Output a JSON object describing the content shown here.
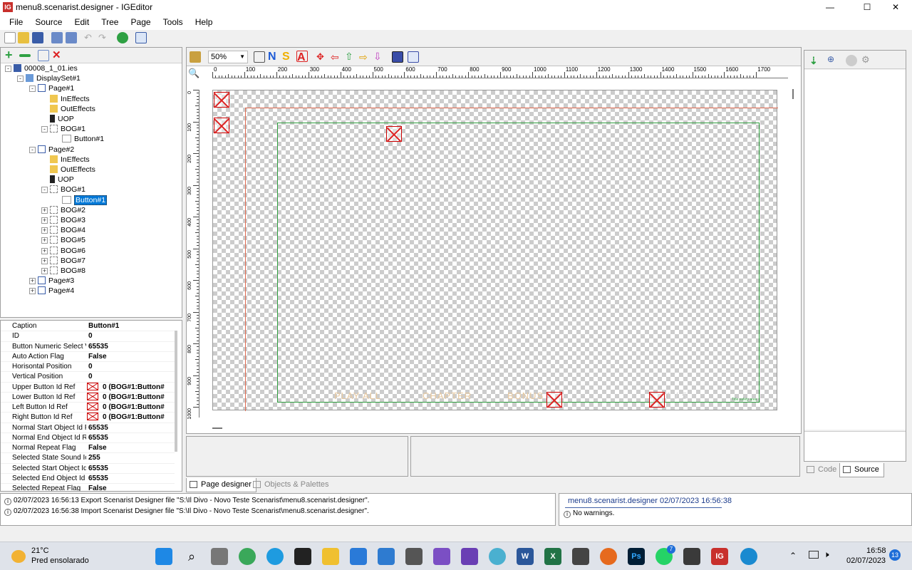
{
  "window": {
    "title": "menu8.scenarist.designer - IGEditor",
    "app_icon": "IG",
    "minimize": "—",
    "maximize": "☐",
    "close": "✕"
  },
  "menu": [
    "File",
    "Source",
    "Edit",
    "Tree",
    "Page",
    "Tools",
    "Help"
  ],
  "tree": [
    {
      "label": "00008_1_01.ies",
      "icon": "project-icon",
      "exp": "-"
    },
    {
      "label": "DisplaySet#1",
      "icon": "displayset-icon",
      "exp": "-"
    },
    {
      "label": "Page#1",
      "icon": "page-icon",
      "exp": "-"
    },
    {
      "label": "InEffects",
      "icon": "folder-icon"
    },
    {
      "label": "OutEffects",
      "icon": "folder-icon"
    },
    {
      "label": "UOP",
      "icon": "uop-icon"
    },
    {
      "label": "BOG#1",
      "icon": "bog-icon",
      "exp": "-"
    },
    {
      "label": "Button#1",
      "icon": "button-icon"
    },
    {
      "label": "Page#2",
      "icon": "page-icon",
      "exp": "-"
    },
    {
      "label": "InEffects",
      "icon": "folder-icon"
    },
    {
      "label": "OutEffects",
      "icon": "folder-icon"
    },
    {
      "label": "UOP",
      "icon": "uop-icon"
    },
    {
      "label": "BOG#1",
      "icon": "bog-icon",
      "exp": "-"
    },
    {
      "label": "Button#1",
      "icon": "button-icon",
      "selected": true
    },
    {
      "label": "BOG#2",
      "icon": "bog-icon",
      "exp": "+"
    },
    {
      "label": "BOG#3",
      "icon": "bog-icon",
      "exp": "+"
    },
    {
      "label": "BOG#4",
      "icon": "bog-icon",
      "exp": "+"
    },
    {
      "label": "BOG#5",
      "icon": "bog-icon",
      "exp": "+"
    },
    {
      "label": "BOG#6",
      "icon": "bog-icon",
      "exp": "+"
    },
    {
      "label": "BOG#7",
      "icon": "bog-icon",
      "exp": "+"
    },
    {
      "label": "BOG#8",
      "icon": "bog-icon",
      "exp": "+"
    },
    {
      "label": "Page#3",
      "icon": "page-icon",
      "exp": "+"
    },
    {
      "label": "Page#4",
      "icon": "page-icon",
      "exp": "+"
    }
  ],
  "properties": [
    {
      "name": "Caption",
      "value": "Button#1"
    },
    {
      "name": "ID",
      "value": "0"
    },
    {
      "name": "Button Numeric Select V",
      "value": "65535"
    },
    {
      "name": "Auto Action Flag",
      "value": "False"
    },
    {
      "name": "Horisontal Position",
      "value": "0"
    },
    {
      "name": "Vertical Position",
      "value": "0"
    },
    {
      "name": "Upper Button Id Ref",
      "value": "0 (BOG#1:Button#",
      "icon": "broken-image-icon"
    },
    {
      "name": "Lower Button Id Ref",
      "value": "0 (BOG#1:Button#",
      "icon": "broken-image-icon"
    },
    {
      "name": "Left Button Id Ref",
      "value": "0 (BOG#1:Button#",
      "icon": "broken-image-icon"
    },
    {
      "name": "Right Button Id Ref",
      "value": "0 (BOG#1:Button#",
      "icon": "broken-image-icon"
    },
    {
      "name": "Normal Start Object Id R",
      "value": "65535"
    },
    {
      "name": "Normal End Object Id Re",
      "value": "65535"
    },
    {
      "name": "Normal Repeat Flag",
      "value": "False"
    },
    {
      "name": "Selected State Sound Ic",
      "value": "255"
    },
    {
      "name": "Selected Start Object Id",
      "value": "65535"
    },
    {
      "name": "Selected End Object Id",
      "value": "65535"
    },
    {
      "name": "Selected Repeat Flag",
      "value": "False"
    }
  ],
  "designer": {
    "zoom": "50%",
    "ruler_top": [
      "0",
      "100",
      "200",
      "300",
      "400",
      "500",
      "600",
      "700",
      "800",
      "900",
      "1000",
      "1100",
      "1200",
      "1300",
      "1400",
      "1500",
      "1600",
      "1700"
    ],
    "ruler_left": [
      "0",
      "100",
      "200",
      "300",
      "400",
      "500",
      "600",
      "700",
      "800",
      "900",
      "1000"
    ],
    "canvas_texts": [
      "PLAY ALL",
      "CHAPTER",
      "BONUS",
      "1 / 5"
    ],
    "safe_area_label": "Title safety area"
  },
  "tabs": {
    "page_designer": "Page designer",
    "objects_palettes": "Objects & Palettes",
    "code": "Code",
    "source": "Source"
  },
  "log": [
    "02/07/2023 16:56:13 Export Scenarist Designer file \"S:\\Il Divo - Novo Teste Scenarist\\menu8.scenarist.designer\".",
    "02/07/2023 16:56:38 Import Scenarist Designer file \"S:\\Il Divo - Novo Teste Scenarist\\menu8.scenarist.designer\"."
  ],
  "status": {
    "header": "menu8.scenarist.designer 02/07/2023 16:56:38",
    "message": "No warnings."
  },
  "taskbar": {
    "temp": "21°C",
    "weather": "Pred ensolarado",
    "time": "16:58",
    "date": "02/07/2023",
    "notif": "13",
    "whatsapp_badge": "7",
    "ig_label": "IG",
    "ps_label": "Ps"
  },
  "colors": {
    "accent": "#0078d7",
    "safe_green": "#2e9e3e",
    "action_red": "#e06a50"
  }
}
